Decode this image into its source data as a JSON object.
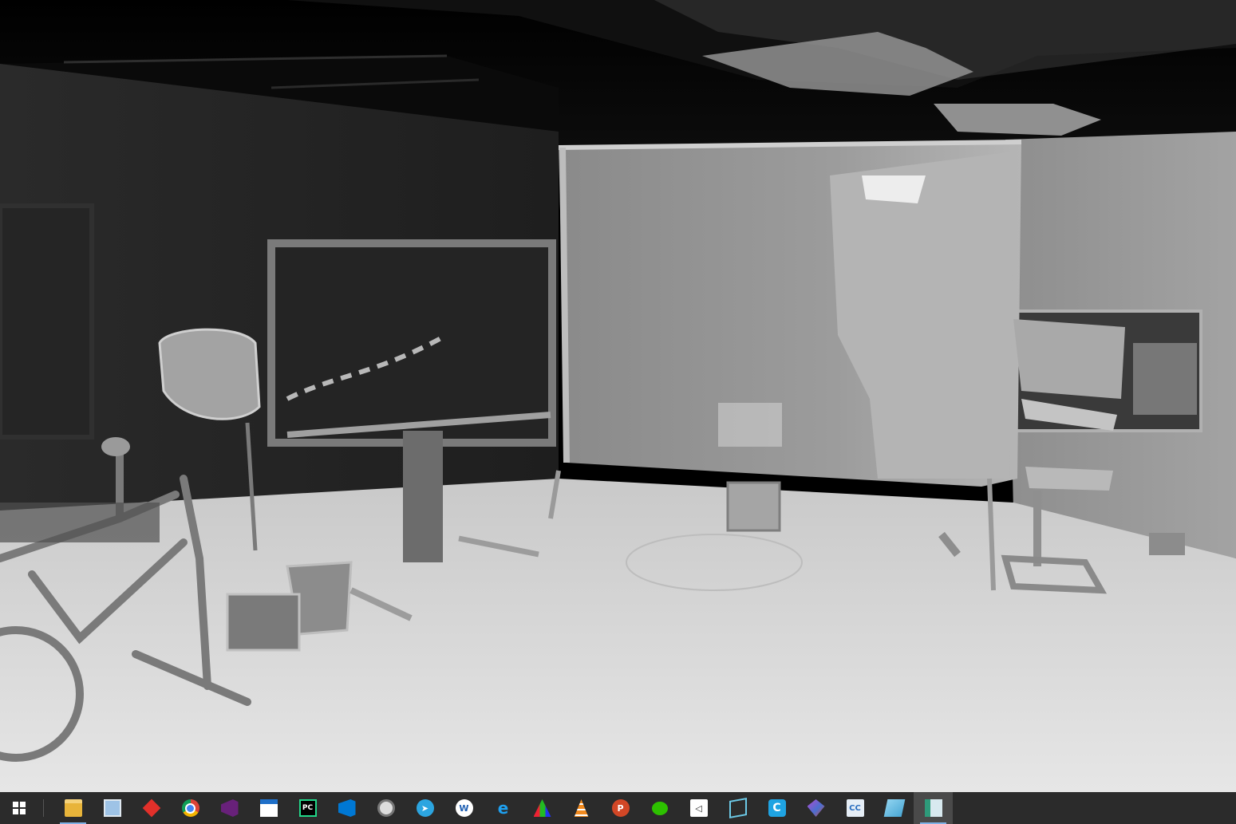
{
  "app": {
    "view": "3D mesh reconstruction viewer (grayscale shaded surface)"
  },
  "colors": {
    "taskbar_bg": "#2b2b2b",
    "active_app_bg": "#4a4a4a",
    "running_indicator": "#7fb2e6"
  },
  "taskbar": {
    "start_icon": "windows-logo-icon",
    "apps": [
      {
        "name": "file-explorer",
        "icon": "folder-icon",
        "running": true,
        "active": false
      },
      {
        "name": "photos-viewer",
        "icon": "image-viewer-icon",
        "running": false,
        "active": false
      },
      {
        "name": "red-diamond-app",
        "icon": "red-diamond-icon",
        "running": false,
        "active": false
      },
      {
        "name": "chrome",
        "icon": "chrome-icon",
        "running": false,
        "active": false
      },
      {
        "name": "visual-studio",
        "icon": "visual-studio-icon",
        "running": false,
        "active": false
      },
      {
        "name": "window-app",
        "icon": "window-icon",
        "running": false,
        "active": false
      },
      {
        "name": "pycharm",
        "icon": "pycharm-icon",
        "running": false,
        "active": false
      },
      {
        "name": "vscode",
        "icon": "vscode-icon",
        "running": false,
        "active": false
      },
      {
        "name": "eye-app",
        "icon": "eye-icon",
        "running": false,
        "active": false
      },
      {
        "name": "telegram",
        "icon": "telegram-icon",
        "running": false,
        "active": false
      },
      {
        "name": "wps-writer",
        "icon": "w-circle-icon",
        "running": false,
        "active": false
      },
      {
        "name": "internet-explorer",
        "icon": "ie-icon",
        "running": false,
        "active": false
      },
      {
        "name": "triangle-app",
        "icon": "colored-triangle-icon",
        "running": false,
        "active": false
      },
      {
        "name": "vlc",
        "icon": "vlc-cone-icon",
        "running": false,
        "active": false
      },
      {
        "name": "wps-presentation",
        "icon": "p-circle-icon",
        "running": false,
        "active": false
      },
      {
        "name": "wechat",
        "icon": "wechat-icon",
        "running": false,
        "active": false
      },
      {
        "name": "unity",
        "icon": "unity-icon",
        "running": false,
        "active": false
      },
      {
        "name": "cube-app",
        "icon": "wire-cube-icon",
        "running": false,
        "active": false
      },
      {
        "name": "c-app",
        "icon": "c-square-icon",
        "running": false,
        "active": false
      },
      {
        "name": "gem-app",
        "icon": "gem-icon",
        "running": false,
        "active": false
      },
      {
        "name": "cloudcompare",
        "icon": "cc-icon",
        "running": false,
        "active": false
      },
      {
        "name": "notepad-app",
        "icon": "pad-icon",
        "running": false,
        "active": false
      },
      {
        "name": "mesh-viewer",
        "icon": "viewer-window-icon",
        "running": true,
        "active": true
      }
    ]
  }
}
